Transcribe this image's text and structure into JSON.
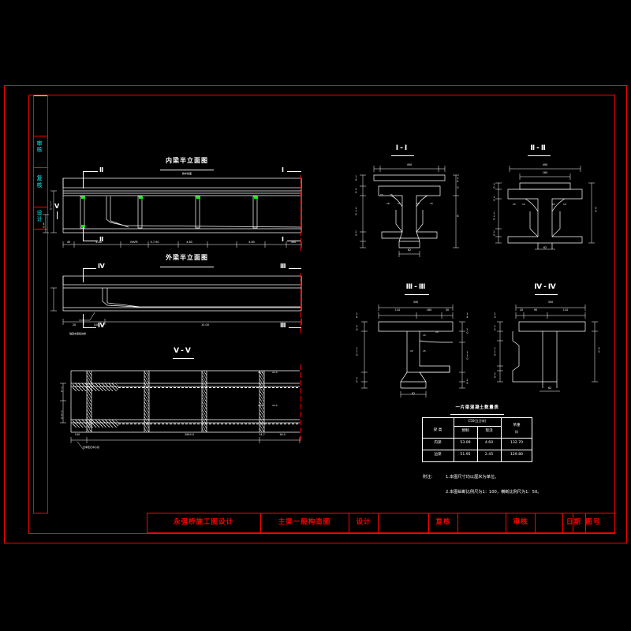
{
  "drawing": {
    "type": "cad-engineering-drawing",
    "background": "#000000",
    "frame_color": "#ff0000",
    "line_color": "#ffffff",
    "accent_color": "#00ffff"
  },
  "left_margin": {
    "cells": [
      {
        "label": "",
        "text": ""
      },
      {
        "label": "cell-2",
        "text": "审核"
      },
      {
        "label": "cell-3",
        "text": "复核"
      },
      {
        "label": "cell-4",
        "text": "设计"
      }
    ]
  },
  "views": {
    "inner_elevation": {
      "title": "内梁半立面图",
      "center_note": "跨中截面",
      "marks": {
        "left_top": "Ⅱ",
        "right_top": "Ⅰ",
        "left_bot": "Ⅱ",
        "right_bot": "Ⅰ"
      },
      "dims": [
        "40",
        "4.80",
        "MAPE",
        "0.7.90",
        "4.80",
        "4.80",
        "300"
      ],
      "side_dims": [
        "170",
        "40"
      ],
      "vmark": "Ⅴ"
    },
    "outer_elevation": {
      "title": "外梁半立面图",
      "marks": {
        "left_top": "Ⅳ",
        "right_top": "Ⅲ",
        "left_bot": "Ⅳ",
        "right_bot": "Ⅲ"
      },
      "dims": [
        "20",
        "100",
        "15.00"
      ],
      "leader_note": "锚固支座板边缘"
    },
    "vv_plan": {
      "title": "Ⅴ-Ⅴ",
      "dims": [
        "140",
        "2849.0",
        "24.7",
        "16.0"
      ],
      "labels": [
        "16.0",
        "24.0",
        "16.0",
        "24.0"
      ],
      "leader_note": "支承垫石中心线",
      "side_dims": [
        "74",
        "140"
      ]
    },
    "section_1": {
      "title": "Ⅰ-Ⅰ",
      "top_dim": "490",
      "left_dims": [
        "14",
        "20",
        "170",
        "25",
        "24"
      ],
      "right_dims": [
        "14.0",
        "8"
      ],
      "bottom_dim": "62",
      "inner_labels": [
        "15",
        "15",
        "18",
        "15",
        "15",
        "15",
        "20",
        "20"
      ]
    },
    "section_2": {
      "title": "Ⅱ-Ⅱ",
      "top_dims": [
        "490",
        "160"
      ],
      "left_dims": [
        "20",
        "15",
        "110",
        "20",
        "13",
        "11"
      ],
      "right_dims": [
        "55"
      ],
      "bottom_dim": "62",
      "inner_labels": [
        "15",
        "15",
        "15",
        "15"
      ]
    },
    "section_3": {
      "title": "Ⅲ-Ⅲ",
      "top_dims": [
        "340",
        "110",
        "180",
        "30"
      ],
      "left_dims": [
        "14",
        "20",
        "170",
        "25",
        "24"
      ],
      "right_dims": [
        "14",
        "20",
        "110",
        "25",
        "24"
      ],
      "bottom_dim": "62",
      "inner_labels": [
        "15",
        "15",
        "15",
        "15"
      ]
    },
    "section_4": {
      "title": "Ⅳ-Ⅳ",
      "top_dims": [
        "340",
        "20",
        "90",
        "110"
      ],
      "left_dims": [
        "20",
        "15",
        "110",
        "20",
        "13",
        "11"
      ],
      "right_dims": [
        "55"
      ],
      "bottom_dim": "62"
    }
  },
  "quantity_table": {
    "title": "一片梁混凝土数量表",
    "header_row1": [
      "梁 类",
      "C50(立方米)",
      "吊重"
    ],
    "header_row2": [
      "预制",
      "现浇",
      "(t)"
    ],
    "rows": [
      {
        "type": "内梁",
        "precast": "53.09",
        "cast_in_situ": "4.60",
        "weight": "132.70"
      },
      {
        "type": "边梁",
        "precast": "51.95",
        "cast_in_situ": "2.45",
        "weight": "129.80"
      }
    ]
  },
  "notes": {
    "label": "附注：",
    "items": [
      "1.本图尺寸均以厘米为单位。",
      "2.本图纵断比例尺为1：100，横断比例尺为1：50。"
    ]
  },
  "title_block": {
    "project": "永强桥施工图设计",
    "drawing_name": "主梁一般构造图",
    "fields": [
      {
        "label": "设计",
        "value": ""
      },
      {
        "label": "复核",
        "value": ""
      },
      {
        "label": "审核",
        "value": ""
      },
      {
        "label": "图号",
        "value": ""
      },
      {
        "label": "日期",
        "value": ""
      }
    ]
  }
}
